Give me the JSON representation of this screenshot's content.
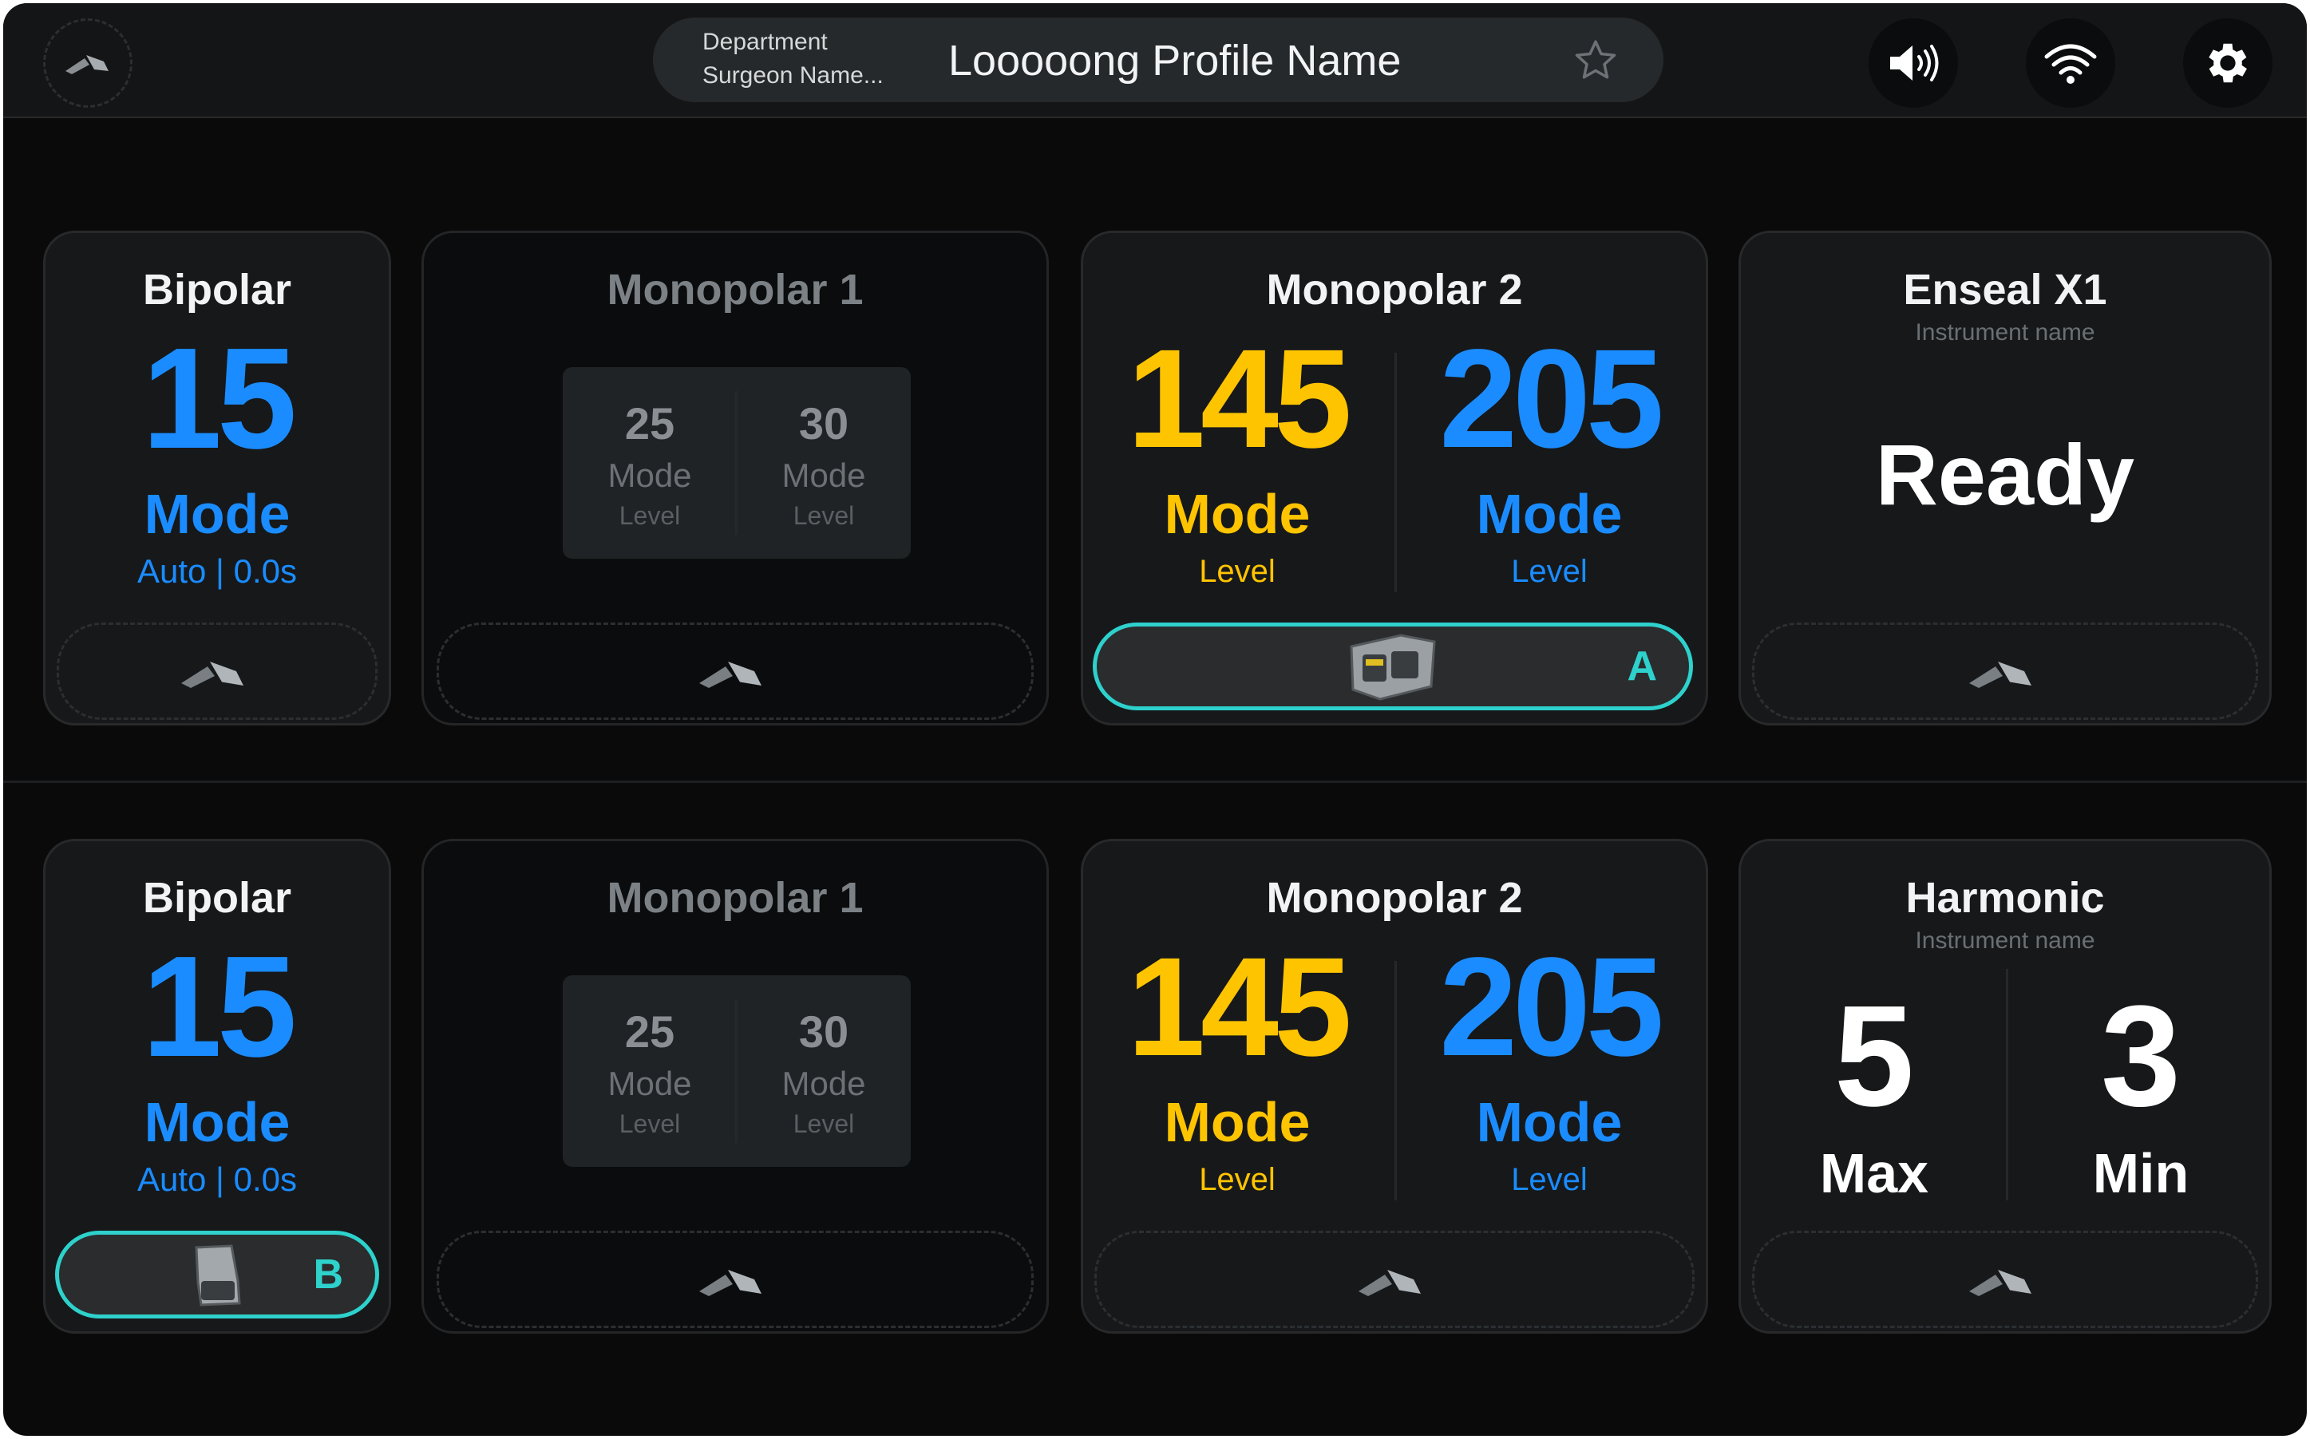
{
  "header": {
    "department": "Department",
    "surgeon": "Surgeon Name...",
    "profile_name": "Looooong Profile Name",
    "icons": {
      "pedal": "footswitch-icon",
      "favorite": "star-icon",
      "sound": "speaker-icon",
      "wifi": "wifi-icon",
      "settings": "gear-icon"
    }
  },
  "colors": {
    "accent_blue": "#1a8cff",
    "accent_yellow": "#ffc400",
    "active_outline": "#2ed1cc"
  },
  "rows": [
    {
      "bipolar": {
        "title": "Bipolar",
        "value": "15",
        "mode": "Mode",
        "auto": "Auto | 0.0s",
        "slot": {
          "letter": ""
        }
      },
      "mono1": {
        "title": "Monopolar 1",
        "left": {
          "value": "25",
          "mode": "Mode",
          "level": "Level"
        },
        "right": {
          "value": "30",
          "mode": "Mode",
          "level": "Level"
        }
      },
      "mono2": {
        "title": "Monopolar 2",
        "left": {
          "value": "145",
          "mode": "Mode",
          "level": "Level"
        },
        "right": {
          "value": "205",
          "mode": "Mode",
          "level": "Level"
        },
        "slot": {
          "letter": "A"
        }
      },
      "right": {
        "title": "Enseal X1",
        "subtitle": "Instrument name",
        "status": "Ready"
      }
    },
    {
      "bipolar": {
        "title": "Bipolar",
        "value": "15",
        "mode": "Mode",
        "auto": "Auto | 0.0s",
        "slot": {
          "letter": "B"
        }
      },
      "mono1": {
        "title": "Monopolar 1",
        "left": {
          "value": "25",
          "mode": "Mode",
          "level": "Level"
        },
        "right": {
          "value": "30",
          "mode": "Mode",
          "level": "Level"
        }
      },
      "mono2": {
        "title": "Monopolar 2",
        "left": {
          "value": "145",
          "mode": "Mode",
          "level": "Level"
        },
        "right": {
          "value": "205",
          "mode": "Mode",
          "level": "Level"
        }
      },
      "right": {
        "title": "Harmonic",
        "subtitle": "Instrument name",
        "max_value": "5",
        "max_label": "Max",
        "min_value": "3",
        "min_label": "Min"
      }
    }
  ]
}
